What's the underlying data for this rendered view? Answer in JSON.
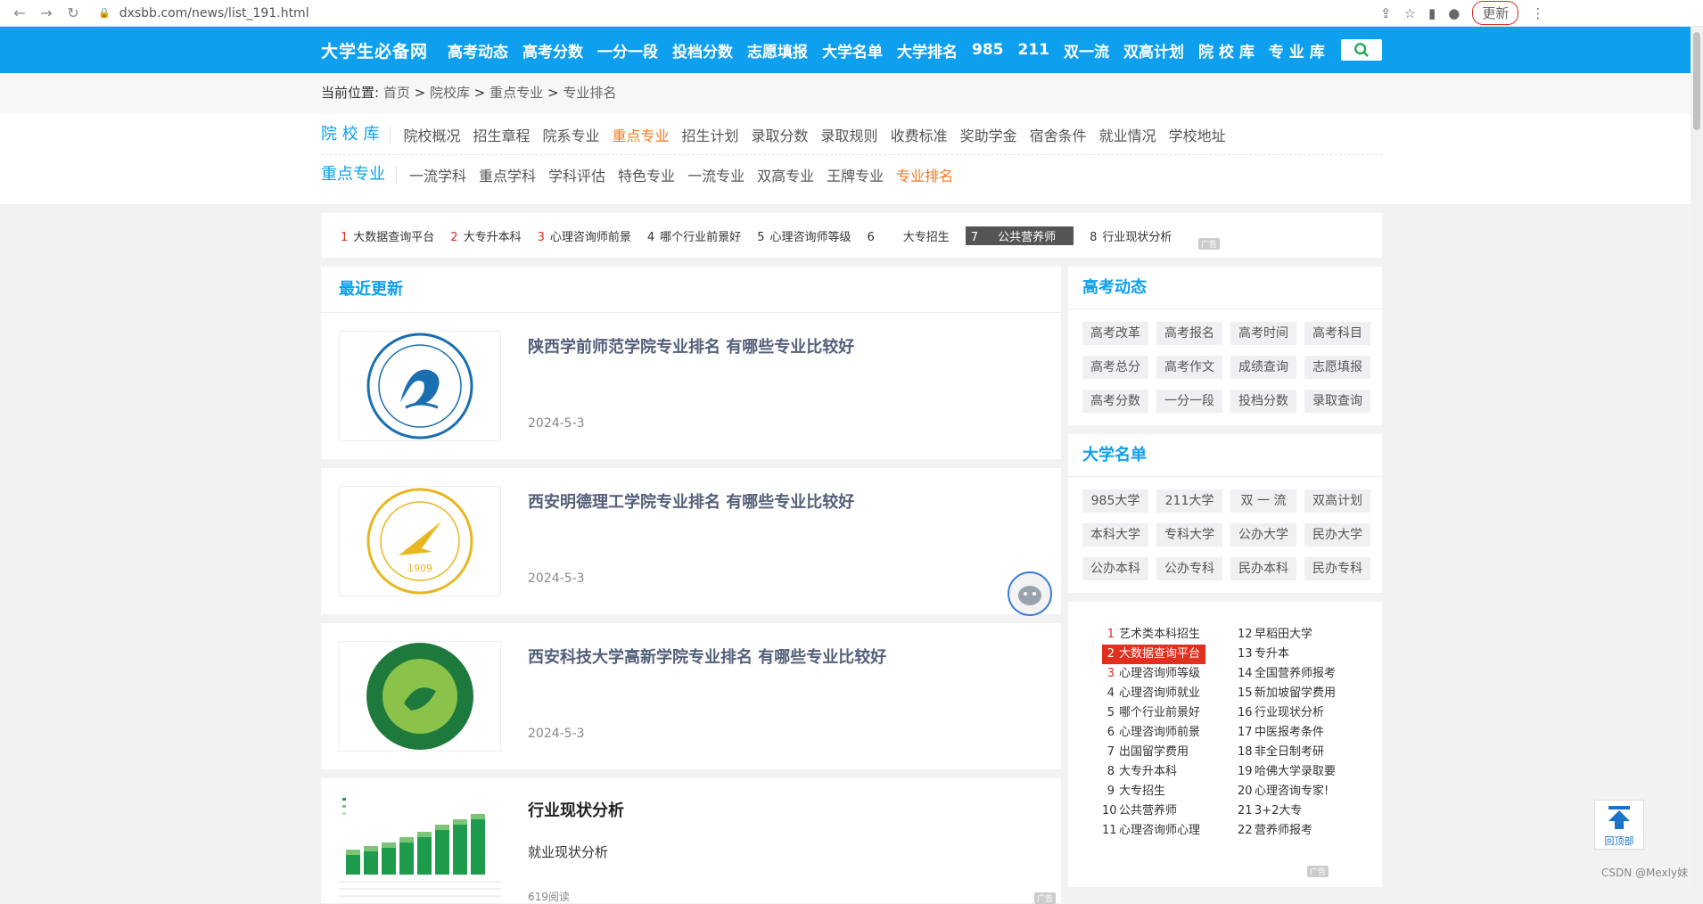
{
  "browser": {
    "url": "dxsbb.com/news/list_191.html",
    "update_label": "更新"
  },
  "site": {
    "logo": "大学生必备网",
    "nav": [
      "高考动态",
      "高考分数",
      "一分一段",
      "投档分数",
      "志愿填报",
      "大学名单",
      "大学排名",
      "985",
      "211",
      "双一流",
      "双高计划",
      "院 校 库",
      "专 业 库"
    ]
  },
  "breadcrumb": {
    "prefix": "当前位置:",
    "items": [
      "首页",
      "院校库",
      "重点专业",
      "专业排名"
    ],
    "sep": ">"
  },
  "subnav": {
    "row1_head": "院 校 库",
    "row1": [
      "院校概况",
      "招生章程",
      "院系专业",
      "重点专业",
      "招生计划",
      "录取分数",
      "录取规则",
      "收费标准",
      "奖助学金",
      "宿舍条件",
      "就业情况",
      "学校地址"
    ],
    "row1_active": "重点专业",
    "row2_head": "重点专业",
    "row2": [
      "一流学科",
      "重点学科",
      "学科评估",
      "特色专业",
      "一流专业",
      "双高专业",
      "王牌专业",
      "专业排名"
    ],
    "row2_active": "专业排名"
  },
  "ad_strip": [
    {
      "num": "1",
      "text": "大数据查询平台"
    },
    {
      "num": "2",
      "text": "大专升本科"
    },
    {
      "num": "3",
      "text": "心理咨询师前景"
    },
    {
      "num": "4",
      "text": "哪个行业前景好"
    },
    {
      "num": "5",
      "text": "心理咨询师等级"
    },
    {
      "num": "6",
      "text": "大专招生"
    },
    {
      "num": "7",
      "text": "公共营养师"
    },
    {
      "num": "8",
      "text": "行业现状分析"
    }
  ],
  "ad_label": "广告",
  "latest": {
    "title": "最近更新",
    "articles": [
      {
        "title": "陕西学前师范学院专业排名 有哪些专业比较好",
        "date": "2024-5-3"
      },
      {
        "title": "西安明德理工学院专业排名 有哪些专业比较好",
        "date": "2024-5-3"
      },
      {
        "title": "西安科技大学高新学院专业排名 有哪些专业比较好",
        "date": "2024-5-3"
      }
    ],
    "ad": {
      "title": "行业现状分析",
      "desc": "就业现状分析",
      "reads": "619阅读"
    }
  },
  "gaokao": {
    "title": "高考动态",
    "tags": [
      "高考改革",
      "高考报名",
      "高考时间",
      "高考科目",
      "高考总分",
      "高考作文",
      "成绩查询",
      "志愿填报",
      "高考分数",
      "一分一段",
      "投档分数",
      "录取查询"
    ]
  },
  "daxue": {
    "title": "大学名单",
    "tags": [
      "985大学",
      "211大学",
      "双 一 流",
      "双高计划",
      "本科大学",
      "专科大学",
      "公办大学",
      "民办大学",
      "公办本科",
      "公办专科",
      "民办本科",
      "民办专科"
    ]
  },
  "ranklist": {
    "col1": [
      {
        "num": "1",
        "text": "艺术类本科招生"
      },
      {
        "num": "2",
        "text": "大数据查询平台"
      },
      {
        "num": "3",
        "text": "心理咨询师等级"
      },
      {
        "num": "4",
        "text": "心理咨询师就业"
      },
      {
        "num": "5",
        "text": "哪个行业前景好"
      },
      {
        "num": "6",
        "text": "心理咨询师前景"
      },
      {
        "num": "7",
        "text": "出国留学费用"
      },
      {
        "num": "8",
        "text": "大专升本科"
      },
      {
        "num": "9",
        "text": "大专招生"
      },
      {
        "num": "10",
        "text": "公共营养师"
      },
      {
        "num": "11",
        "text": "心理咨询师心理"
      }
    ],
    "col2": [
      {
        "num": "12",
        "text": "早稻田大学"
      },
      {
        "num": "13",
        "text": "专升本"
      },
      {
        "num": "14",
        "text": "全国营养师报考"
      },
      {
        "num": "15",
        "text": "新加坡留学费用"
      },
      {
        "num": "16",
        "text": "行业现状分析"
      },
      {
        "num": "17",
        "text": "中医报考条件"
      },
      {
        "num": "18",
        "text": "非全日制考研"
      },
      {
        "num": "19",
        "text": "哈佛大学录取要"
      },
      {
        "num": "20",
        "text": "心理咨询专家!"
      },
      {
        "num": "21",
        "text": "3+2大专"
      },
      {
        "num": "22",
        "text": "营养师报考"
      }
    ]
  },
  "float": {
    "backtop": "回顶部",
    "watermark": "CSDN @Mexly妹"
  },
  "colors": {
    "brand": "#0ea0ef",
    "active": "#f47a20",
    "rank_red": "#d93025"
  }
}
